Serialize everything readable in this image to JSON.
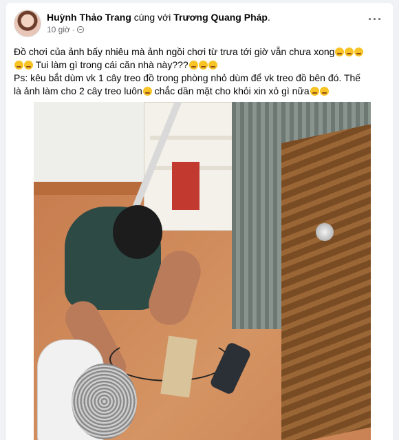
{
  "post": {
    "author": "Huỳnh Thảo Trang",
    "with_text": "cùng với",
    "tagged": "Trương Quang Pháp",
    "period": ".",
    "time": "10 giờ",
    "dot": "·",
    "more": "···",
    "line1": "Đồ chơi của ảnh bấy nhiêu mà ảnh ngồi chơi từ trưa tới giờ vẫn chưa xong",
    "line2": "Tui  làm gì trong cái căn nhà này???",
    "line3": "Ps: kêu bắt dùm vk 1 cây treo đồ trong phòng nhỏ dùm để vk treo đồ bên đó. Thế",
    "line4": "là ảnh làm cho 2 cây treo luôn",
    "line4b": " chắc dần mặt cho khỏi xin xỏ gì nữa",
    "icons": {
      "avatar": "avatar",
      "globe": "globe-icon",
      "emoji": "laughing-emoji-icon"
    }
  }
}
